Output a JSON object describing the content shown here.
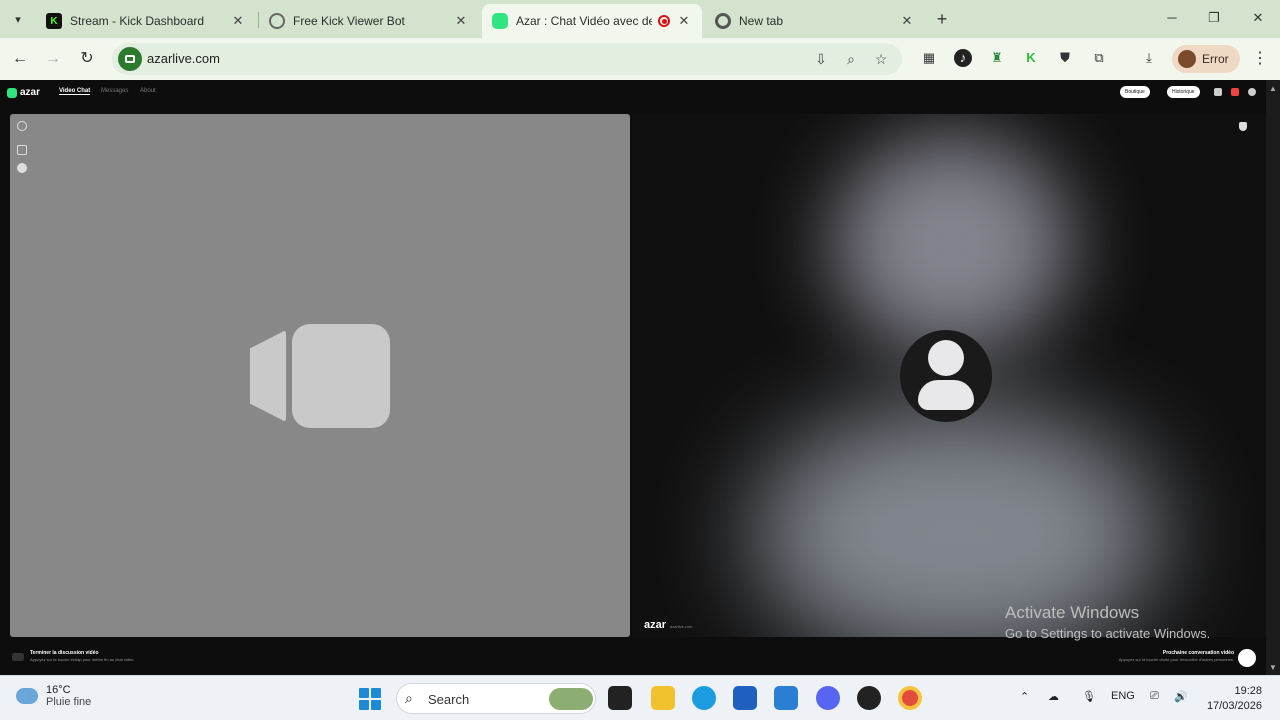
{
  "browser": {
    "tabs": [
      {
        "title": "Stream - Kick Dashboard",
        "favicon": "kick-icon"
      },
      {
        "title": "Free Kick Viewer Bot",
        "favicon": "globe-icon"
      },
      {
        "title": "Azar : Chat Vidéo avec de n",
        "favicon": "azar-icon",
        "active": true,
        "recording": true
      },
      {
        "title": "New tab",
        "favicon": "chrome-icon"
      }
    ],
    "url": "azarlive.com",
    "profile_label": "Error"
  },
  "azar": {
    "logo": "azar",
    "nav": [
      "Video Chat",
      "Messages",
      "About"
    ],
    "header_pills": [
      "Boutique",
      "Historique"
    ],
    "watermark": "azar",
    "watermark_sub": "azarlive.com",
    "bottom_left_title": "Terminer la discussion vidéo",
    "bottom_left_sub": "Appuyez sur la touche échap pour mettre fin au chat vidéo.",
    "bottom_right_title": "Prochaine conversation vidéo",
    "bottom_right_sub": "Appuyez sur la touche droite pour rencontrer d'autres personnes."
  },
  "windows_activation": {
    "line1": "Activate Windows",
    "line2": "Go to Settings to activate Windows."
  },
  "taskbar": {
    "temperature": "16°C",
    "condition": "Pluie fine",
    "search_label": "Search",
    "language": "ENG",
    "time": "19:28",
    "date": "17/03/2026"
  },
  "colors": {
    "tabstrip": "#d3e3cd",
    "toolbar": "#f2f7ee",
    "azar_green": "#2ee57f",
    "kick_green": "#53fc18"
  }
}
